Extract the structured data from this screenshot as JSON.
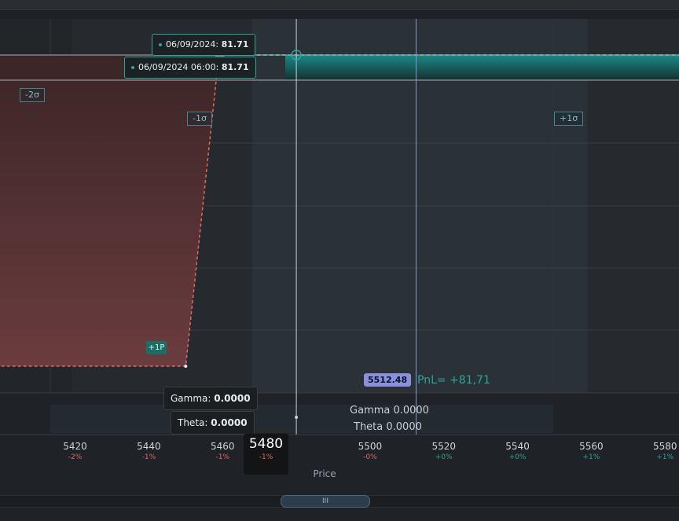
{
  "tooltips": {
    "top": {
      "date": "06/09/2024",
      "value": "81.71"
    },
    "bottom": {
      "date": "06/09/2024 06:00",
      "value": "81.71"
    }
  },
  "sigma_labels": {
    "minus2": "-2σ",
    "minus1": "-1σ",
    "plus1": "+1σ"
  },
  "position_marker": "+1P",
  "price_badge": "5512.48",
  "pnl_text": "PnL= +81,71",
  "greeks": {
    "gamma_tip_label": "Gamma:",
    "gamma_tip_value": "0.0000",
    "theta_tip_label": "Theta:",
    "theta_tip_value": "0.0000",
    "gamma_row": "Gamma 0.0000",
    "theta_row": "Theta 0.0000"
  },
  "cursor": {
    "price": "5480",
    "pct": "-1%"
  },
  "x_axis": {
    "label": "Price",
    "ticks": [
      {
        "value": "5420",
        "pct": "-2%",
        "sign": "neg"
      },
      {
        "value": "5440",
        "pct": "-1%",
        "sign": "neg"
      },
      {
        "value": "5460",
        "pct": "-1%",
        "sign": "neg"
      },
      {
        "value": "5500",
        "pct": "-0%",
        "sign": "neg"
      },
      {
        "value": "5520",
        "pct": "+0%",
        "sign": "pos"
      },
      {
        "value": "5540",
        "pct": "+0%",
        "sign": "pos"
      },
      {
        "value": "5560",
        "pct": "+1%",
        "sign": "pos"
      },
      {
        "value": "5580",
        "pct": "+1%",
        "sign": "pos"
      }
    ]
  },
  "scrollbar": {
    "grip": "III"
  },
  "colors": {
    "profit": "#2fa39c",
    "loss": "#e06666",
    "current_price": "#8a90d9"
  },
  "chart_data": {
    "type": "line",
    "title": "",
    "xlabel": "Price",
    "ylabel": "",
    "xlim": [
      5407,
      5592
    ],
    "ylim": [
      -25,
      82
    ],
    "series": [
      {
        "x": [
          5400,
          5450,
          5459,
          5477,
          5600
        ],
        "values": [
          -17,
          -17,
          81.71,
          81.71,
          81.71
        ]
      }
    ],
    "current_price": 5512.48,
    "cursor_price": 5480,
    "pnl_at_expiration": 81.71,
    "sigma_levels": {
      "-2σ": 5422,
      "-1σ": 5468,
      "+1σ": 5559
    },
    "greeks": {
      "gamma": 0.0,
      "theta": 0.0
    }
  }
}
